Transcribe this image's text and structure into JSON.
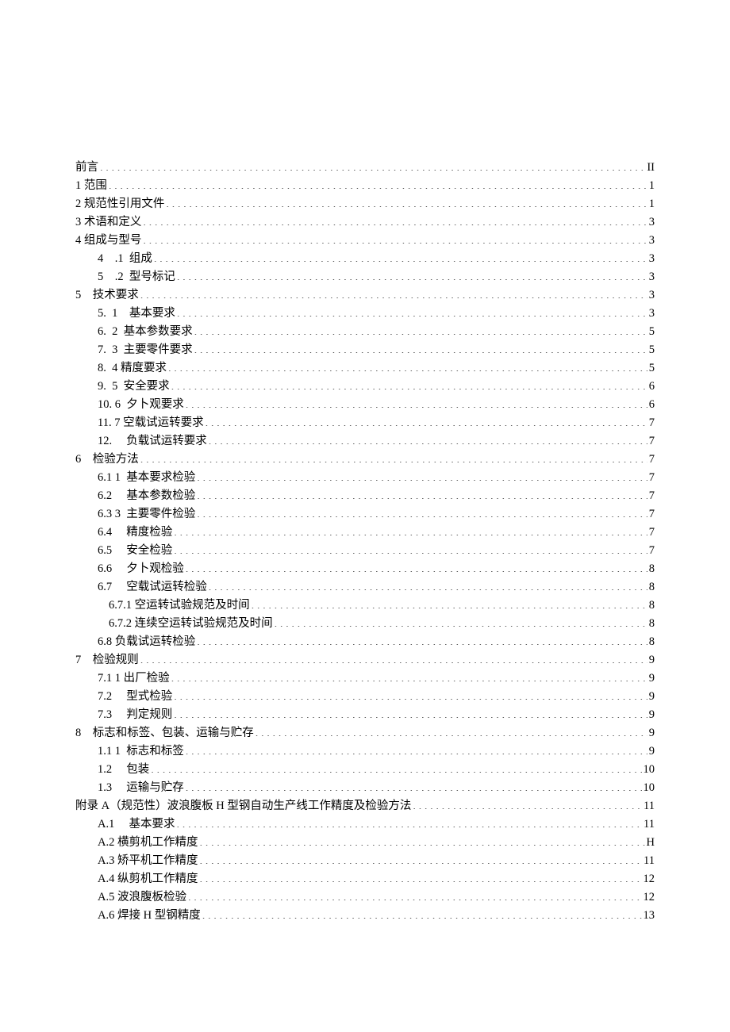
{
  "toc": [
    {
      "label": "前言",
      "page": "II",
      "indent": 0
    },
    {
      "label": "1 范围",
      "page": "1",
      "indent": 0
    },
    {
      "label": "2 规范性引用文件",
      "page": "1",
      "indent": 0
    },
    {
      "label": "3 术语和定义",
      "page": "3",
      "indent": 0
    },
    {
      "label": "4 组成与型号",
      "page": "3",
      "indent": 0
    },
    {
      "label": "4 .1 组成",
      "page": "3",
      "indent": 1
    },
    {
      "label": "5 .2 型号标记",
      "page": "3",
      "indent": 1
    },
    {
      "label": "5 技术要求",
      "page": "3",
      "indent": 0
    },
    {
      "label": "5. 1 基本要求",
      "page": "3",
      "indent": 1
    },
    {
      "label": "6. 2 基本参数要求",
      "page": "5",
      "indent": 1
    },
    {
      "label": "7. 3 主要零件要求",
      "page": "5",
      "indent": 1
    },
    {
      "label": "8. 4 精度要求",
      "page": "5",
      "indent": 1
    },
    {
      "label": "9. 5 安全要求",
      "page": "6",
      "indent": 1
    },
    {
      "label": "10. 6 夕卜观要求",
      "page": "6",
      "indent": 1
    },
    {
      "label": "11. 7 空载试运转要求",
      "page": "7",
      "indent": 1
    },
    {
      "label": "12.  负载试运转要求",
      "page": "7",
      "indent": 1
    },
    {
      "label": "6 检验方法",
      "page": "7",
      "indent": 0
    },
    {
      "label": "6.1 1 基本要求检验",
      "page": "7",
      "indent": 1
    },
    {
      "label": "6.2  基本参数检验",
      "page": "7",
      "indent": 1
    },
    {
      "label": "6.3 3 主要零件检验",
      "page": "7",
      "indent": 1
    },
    {
      "label": "6.4  精度检验",
      "page": "7",
      "indent": 1
    },
    {
      "label": "6.5  安全检验",
      "page": "7",
      "indent": 1
    },
    {
      "label": "6.6  夕卜观检验",
      "page": "8",
      "indent": 1
    },
    {
      "label": "6.7  空载试运转检验",
      "page": "8",
      "indent": 1
    },
    {
      "label": "6.7.1 空运转试验规范及时间",
      "page": "8",
      "indent": 2
    },
    {
      "label": "6.7.2 连续空运转试验规范及时间",
      "page": "8",
      "indent": 2
    },
    {
      "label": "6.8 负载试运转检验",
      "page": "8",
      "indent": 1
    },
    {
      "label": "7 检验规则",
      "page": "9",
      "indent": 0
    },
    {
      "label": "7.1 1 出厂检验",
      "page": "9",
      "indent": 1
    },
    {
      "label": "7.2  型式检验",
      "page": "9",
      "indent": 1
    },
    {
      "label": "7.3  判定规则",
      "page": "9",
      "indent": 1
    },
    {
      "label": "8 标志和标签、包装、运输与贮存",
      "page": "9",
      "indent": 0
    },
    {
      "label": "1.1 1 标志和标签",
      "page": "9",
      "indent": 1
    },
    {
      "label": "1.2  包装",
      "page": "10",
      "indent": 1
    },
    {
      "label": "1.3  运输与贮存",
      "page": "10",
      "indent": 1
    },
    {
      "label": "附录 A（规范性）波浪腹板 H 型钢自动生产线工作精度及检验方法",
      "page": "11",
      "indent": 0
    },
    {
      "label": "A.1  基本要求",
      "page": "11",
      "indent": 1
    },
    {
      "label": "A.2 横剪机工作精度",
      "page": "H",
      "indent": 1
    },
    {
      "label": "A.3 矫平机工作精度",
      "page": "11",
      "indent": 1
    },
    {
      "label": "A.4 纵剪机工作精度",
      "page": "12",
      "indent": 1
    },
    {
      "label": "A.5 波浪腹板检验",
      "page": "12",
      "indent": 1
    },
    {
      "label": "A.6 焊接 H 型钢精度",
      "page": "13",
      "indent": 1
    }
  ]
}
